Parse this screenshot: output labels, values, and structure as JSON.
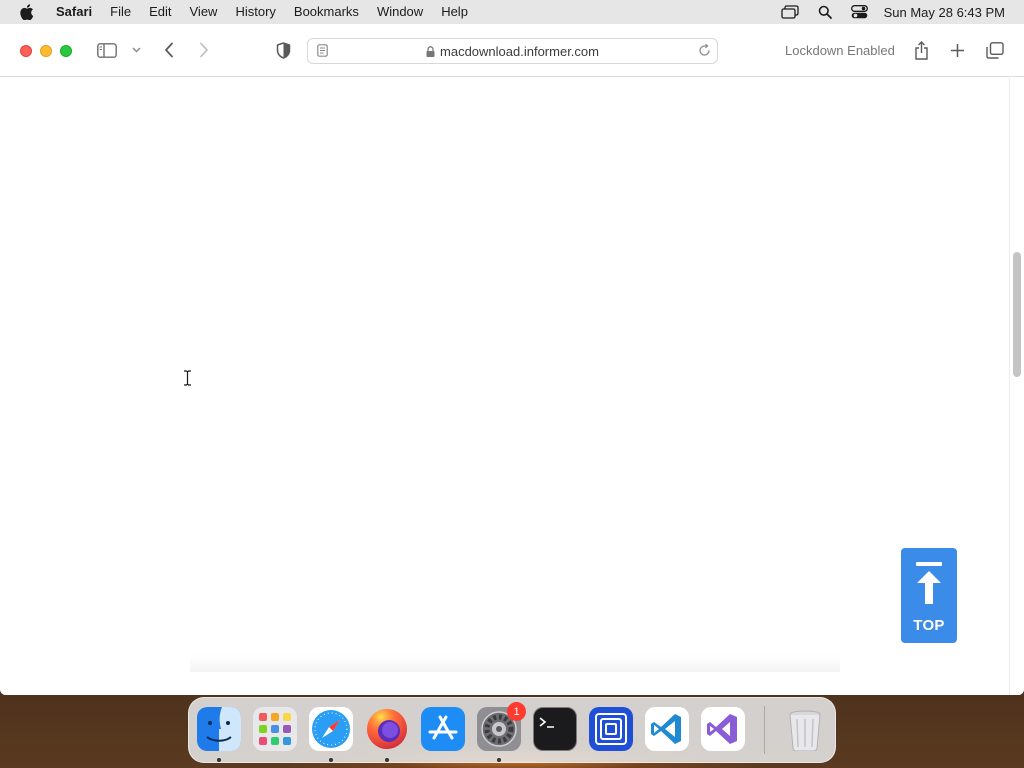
{
  "menubar": {
    "app_name": "Safari",
    "items": [
      "File",
      "Edit",
      "View",
      "History",
      "Bookmarks",
      "Window",
      "Help"
    ],
    "clock": "Sun May 28  6:43 PM"
  },
  "toolbar": {
    "url": "macdownload.informer.com",
    "lockdown_label": "Lockdown Enabled"
  },
  "page": {
    "top_button_label": "TOP",
    "accent_color": "#3b8be9"
  },
  "dock": {
    "apps": [
      "Finder",
      "Launchpad",
      "Safari",
      "Firefox",
      "App Store",
      "System Settings",
      "Terminal",
      "Remote Desktop",
      "Visual Studio Code",
      "Visual Studio",
      "Trash"
    ],
    "system_settings_badge": "1"
  }
}
